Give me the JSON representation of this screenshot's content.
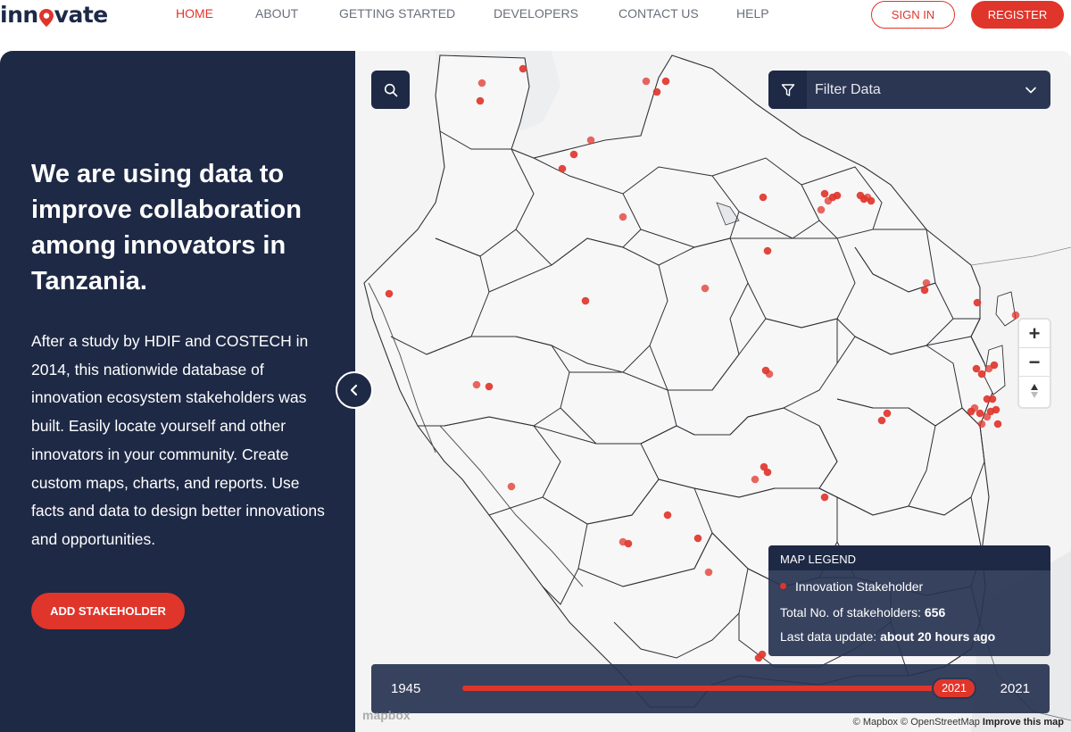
{
  "brand": {
    "name": "innovate",
    "prefix": "inn",
    "suffix": "vate",
    "color": "#1d2a47",
    "accent": "#e0352b"
  },
  "nav": {
    "items": [
      "HOME",
      "ABOUT",
      "GETTING STARTED",
      "DEVELOPERS",
      "CONTACT US",
      "HELP"
    ],
    "active": "HOME",
    "sign_in": "SIGN IN",
    "register": "REGISTER"
  },
  "panel": {
    "title": "We are using data to improve collaboration among innovators in Tanzania.",
    "body": "After a study by HDIF and COSTECH in 2014, this nationwide database of innovation ecosystem stakeholders was built. Easily locate yourself and other innovators in your community. Create custom maps, charts, and reports. Use facts and data to design better innovations and opportunities.",
    "cta": "ADD STAKEHOLDER",
    "background": "#1e2945"
  },
  "map": {
    "filter_placeholder": "Filter Data",
    "zoom_in": "+",
    "zoom_out": "−",
    "legend": {
      "heading": "MAP LEGEND",
      "item": "Innovation Stakeholder",
      "total_label": "Total No. of stakeholders:",
      "total_value": "656",
      "update_label": "Last data update:",
      "update_value": "about 20 hours ago"
    },
    "timeline": {
      "start": "1945",
      "end": "2021",
      "current": "2021",
      "fill": 1.0
    },
    "attribution": {
      "mapbox": "© Mapbox",
      "osm": "© OpenStreetMap",
      "improve": "Improve this map"
    },
    "watermark": "mapbox",
    "marker_color": "#e0352b"
  }
}
